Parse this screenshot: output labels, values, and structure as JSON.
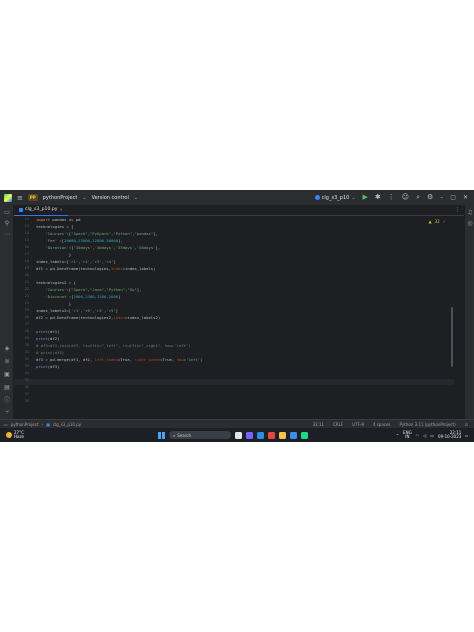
{
  "titlebar": {
    "project_badge": "PP",
    "project_name": "pythonProject",
    "vcs": "Version control",
    "run_config": "clg_s3_p10"
  },
  "tab": {
    "file_name": "clg_s3_p10.py"
  },
  "editor": {
    "inspection": {
      "warnings": "32",
      "ok": "✓"
    },
    "line_numbers": [
      "12",
      "13",
      "14",
      "15",
      "16",
      "17",
      "18",
      "19",
      "20",
      "21",
      "22",
      "23",
      "24",
      "25",
      "26",
      "27",
      "28",
      "29",
      "30",
      "31",
      "32",
      "33",
      "34",
      "35",
      "36",
      "37",
      "38"
    ]
  },
  "code": {
    "l1_kw": "import",
    "l1_rest": " pandas ",
    "l1_kw2": "as",
    "l1_rest2": " pd",
    "l2": "technologies = {",
    "l3_a": "    ",
    "l3_s1": "'Courses'",
    "l3_b": ":[",
    "l3_s2": "\"Spark\"",
    "l3_c": ",",
    "l3_s3": "\"PySpark\"",
    "l3_d": ",",
    "l3_s4": "\"Python\"",
    "l3_e": ",",
    "l3_s5": "\"pandas\"",
    "l3_f": "],",
    "l4_a": "    ",
    "l4_s1": "'Fee'",
    "l4_b": " :[",
    "l4_n": "20000,25000,22000,30000",
    "l4_c": "],",
    "l5_a": "    ",
    "l5_s1": "'Duration'",
    "l5_b": ":[",
    "l5_s2": "'30days'",
    "l5_c": ",",
    "l5_s3": "'40days'",
    "l5_d": ",",
    "l5_s4": "'35days'",
    "l5_e": ",",
    "l5_s5": "'50days'",
    "l5_f": "],",
    "l6": "              }",
    "l7_a": "index_labels=[",
    "l7_s1": "'r1'",
    "l7_b": ",",
    "l7_s2": "'r2'",
    "l7_c": ",",
    "l7_s3": "'r3'",
    "l7_d": ",",
    "l7_s4": "'r4'",
    "l7_e": "]",
    "l8_a": "df1 = pd.DataFrame(technologies,",
    "l8_k": "index",
    "l8_b": "=index_labels)",
    "l9": "",
    "l10": "technologies2 = {",
    "l11_a": "    ",
    "l11_s1": "'Courses'",
    "l11_b": ":[",
    "l11_s2": "\"Spark\"",
    "l11_c": ",",
    "l11_s3": "\"Java\"",
    "l11_d": ",",
    "l11_s4": "\"Python\"",
    "l11_e": ",",
    "l11_s5": "\"Go\"",
    "l11_f": "],",
    "l12_a": "    ",
    "l12_s1": "'Discount'",
    "l12_b": ":[",
    "l12_n": "2000,2300,1200,2000",
    "l12_c": "]",
    "l13": "              }",
    "l14_a": "index_labels2=[",
    "l14_s1": "'r1'",
    "l14_b": ",",
    "l14_s2": "'r6'",
    "l14_c": ",",
    "l14_s3": "'r3'",
    "l14_d": ",",
    "l14_s4": "'r5'",
    "l14_e": "]",
    "l15_a": "df2 = pd.DataFrame(technologies2,",
    "l15_k": "index",
    "l15_b": "=index_labels2)",
    "l16": "",
    "l17_f": "print",
    "l17_a": "(df1)",
    "l18_f": "print",
    "l18_a": "(df2)",
    "l19": "# df3=df1.join(df2, lsuffix=\"_left\", rsuffix=\"_right\", how='left')",
    "l20": "# print(df3)",
    "l21_a": "df3 = pd.merge(df1, df2, ",
    "l21_k1": "left_index",
    "l21_b": "=True, ",
    "l21_k2": "right_index",
    "l21_c": "=True, ",
    "l21_k3": "how",
    "l21_d": "=",
    "l21_s": "'left'",
    "l21_e": ")",
    "l22_f": "print",
    "l22_a": "(df3)"
  },
  "statusbar": {
    "project": "pythonProject",
    "file": "clg_s3_p10.py",
    "position": "32:11",
    "line_sep": "CRLF",
    "encoding": "UTF-8",
    "indent": "4 spaces",
    "interpreter": "Python 3.11 (pythonProject)"
  },
  "taskbar": {
    "temp": "27°C",
    "condition": "Haze",
    "search": "Search",
    "lang_top": "ENG",
    "lang_bottom": "IN",
    "time": "22:11",
    "date": "09-10-2023"
  }
}
